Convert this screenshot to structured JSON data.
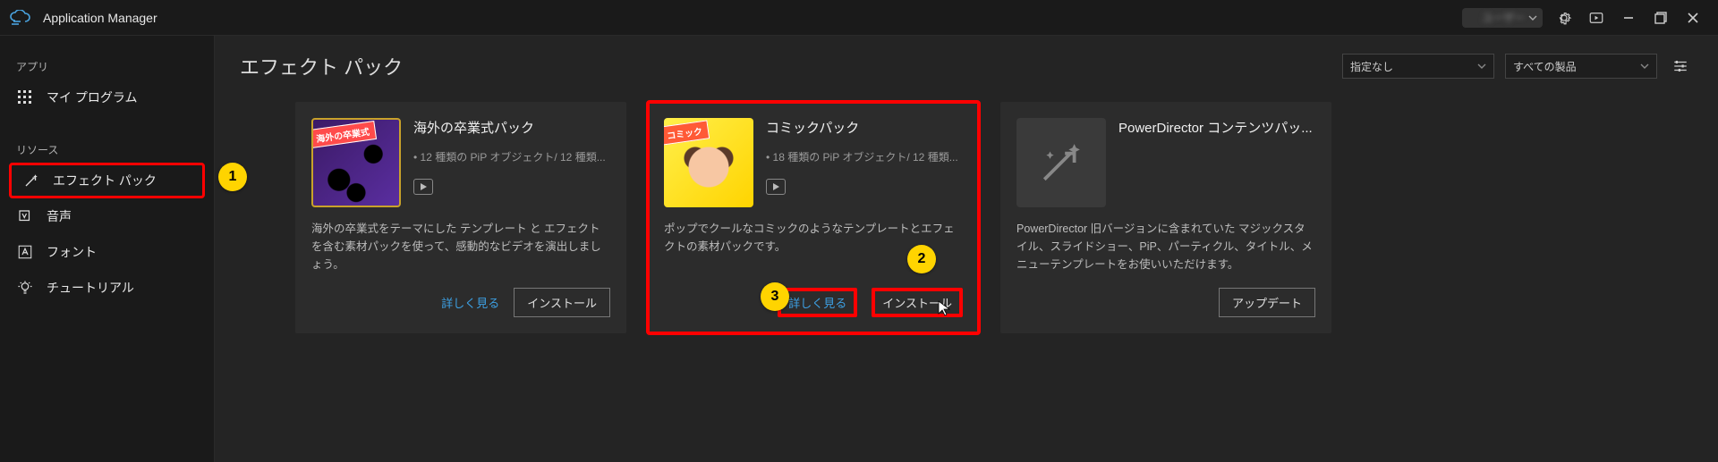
{
  "app": {
    "title": "Application Manager"
  },
  "titlebar": {
    "user_label": "ユーザー"
  },
  "sidebar": {
    "sections": {
      "apps": "アプリ",
      "resources": "リソース"
    },
    "items": {
      "my_programs": "マイ プログラム",
      "effect_packs": "エフェクト パック",
      "audio": "音声",
      "fonts": "フォント",
      "tutorials": "チュートリアル"
    }
  },
  "header": {
    "title": "エフェクト パック",
    "filter1": "指定なし",
    "filter2": "すべての製品"
  },
  "cards": [
    {
      "ribbon": "海外の卒業式",
      "title": "海外の卒業式パック",
      "subtitle": "• 12 種類の PiP オブジェクト/ 12 種類...",
      "desc": "海外の卒業式をテーマにした テンプレート と エフェクトを含む素材パックを使って、感動的なビデオを演出しましょう。",
      "more": "詳しく見る",
      "action": "インストール"
    },
    {
      "ribbon": "コミック",
      "title": "コミックパック",
      "subtitle": "• 18 種類の PiP オブジェクト/ 12 種類...",
      "desc": "ポップでクールなコミックのようなテンプレートとエフェクトの素材パックです。",
      "more": "詳しく見る",
      "action": "インストール"
    },
    {
      "title": "PowerDirector コンテンツパッ...",
      "subtitle": "",
      "desc": "PowerDirector 旧バージョンに含まれていた マジックスタイル、スライドショー、PiP、パーティクル、タイトル、メニューテンプレートをお使いいただけます。",
      "action": "アップデート"
    }
  ],
  "callouts": {
    "c1": "1",
    "c2": "2",
    "c3": "3"
  }
}
